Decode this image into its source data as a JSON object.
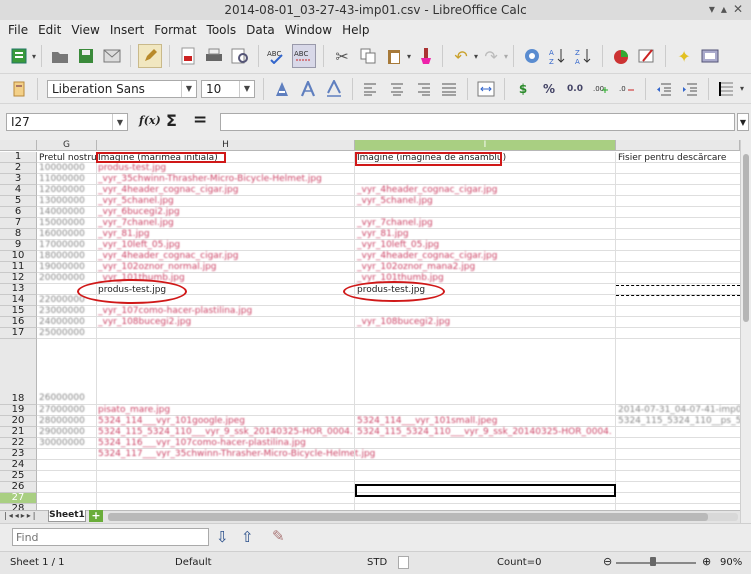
{
  "window": {
    "title": "2014-08-01_03-27-43-imp01.csv - LibreOffice Calc"
  },
  "menu": [
    "File",
    "Edit",
    "View",
    "Insert",
    "Format",
    "Tools",
    "Data",
    "Window",
    "Help"
  ],
  "format_toolbar": {
    "font_name": "Liberation Sans",
    "font_size": "10",
    "currency_symbol": "$",
    "percent_symbol": "%",
    "decimal_symbol": "0.0"
  },
  "formula_bar": {
    "cell_ref": "I27",
    "fx_label": "f(x)",
    "sum_symbol": "Σ",
    "equals_symbol": "=",
    "value": ""
  },
  "columns": [
    {
      "label": "G"
    },
    {
      "label": "H"
    },
    {
      "label": "I"
    },
    {
      "label": ""
    }
  ],
  "rows": [
    "1",
    "2",
    "3",
    "4",
    "5",
    "6",
    "7",
    "8",
    "9",
    "10",
    "11",
    "12",
    "13",
    "14",
    "15",
    "16",
    "17",
    "18",
    "19",
    "20",
    "21",
    "22",
    "23",
    "24",
    "25",
    "26",
    "27",
    "28"
  ],
  "cells": {
    "g1": "Pretul nostru",
    "h1": "Imagine (marimea initiala)",
    "i1": "Imagine (imaginea de ansamblu)",
    "j1": "Fisier pentru descărcare",
    "h13": "produs-test.jpg",
    "i13": "produs-test.jpg"
  },
  "blurred": {
    "g": [
      "10000000",
      "11000000",
      "12000000",
      "13000000",
      "14000000",
      "15000000",
      "16000000",
      "17000000",
      "18000000",
      "19000000",
      "20000000",
      "21000000",
      "22000000",
      "23000000",
      "24000000",
      "25000000",
      "26000000",
      "27000000",
      "28000000",
      "29000000",
      "30000000"
    ],
    "h": [
      "produs-test.jpg",
      "_vyr_35chwinn-Thrasher-Micro-Bicycle-Helmet.jpg",
      "_vyr_4header_cognac_cigar.jpg",
      "_vyr_5chanel.jpg",
      "_vyr_6bucegi2.jpg",
      "_vyr_7chanel.jpg",
      "_vyr_81.jpg",
      "_vyr_10left_05.jpg",
      "_vyr_4header_cognac_cigar.jpg",
      "_vyr_102oznor_normal.jpg",
      "_vyr_101thumb.jpg",
      "",
      "",
      "_vyr_107como-hacer-plastilina.jpg",
      "_vyr_108bucegi2.jpg",
      "",
      "",
      "pisato_mare.jpg",
      "5324_114___vyr_101google.jpeg",
      "5324_115_5324_110___vyr_9_ssk_20140325-HOR_0004.",
      "5324_116___vyr_107como-hacer-plastilina.jpg",
      "5324_117___vyr_35chwinn-Thrasher-Micro-Bicycle-Helmet.jpg"
    ],
    "i": [
      "",
      "",
      "_vyr_4header_cognac_cigar.jpg",
      "_vyr_5chanel.jpg",
      "",
      "_vyr_7chanel.jpg",
      "_vyr_81.jpg",
      "_vyr_10left_05.jpg",
      "_vyr_4header_cognac_cigar.jpg",
      "_vyr_102oznor_mana2.jpg",
      "_vyr_101thumb.jpg",
      "",
      "",
      "",
      "_vyr_108bucegi2.jpg",
      "",
      "",
      "",
      "5324_114___vyr_101small.jpeg",
      "5324_115_5324_110___vyr_9_ssk_20140325-HOR_0004.",
      "",
      "",
      ""
    ],
    "j": [
      "",
      "",
      "",
      "",
      "",
      "",
      "",
      "",
      "",
      "",
      "",
      "",
      "",
      "",
      "",
      "",
      "",
      "2014-07-31_04-07-41-imp01",
      "5324_115_5324_110__ps_5324",
      "",
      "",
      "",
      ""
    ]
  },
  "sheets": {
    "active_tab": "Sheet1"
  },
  "find": {
    "placeholder": "Find"
  },
  "status": {
    "sheet": "Sheet 1 / 1",
    "style": "Default",
    "mode": "STD",
    "count": "Count=0",
    "zoom": "90%"
  }
}
